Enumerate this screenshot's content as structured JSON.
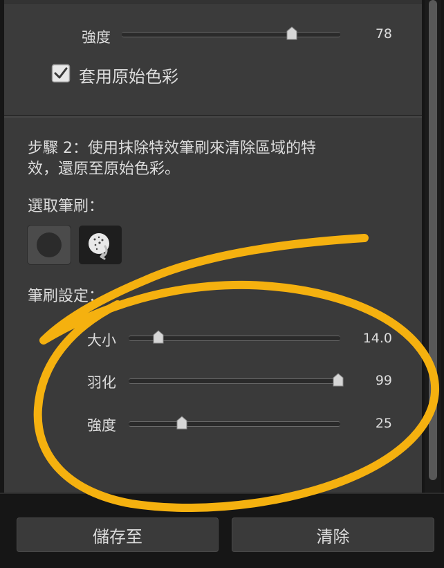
{
  "effect": {
    "strength_label": "強度",
    "strength_value": "78",
    "strength_level": 78,
    "checkbox_label": "套用原始色彩",
    "checkbox_checked": true
  },
  "step2": {
    "instruction_line1": "步驟 2：使用抹除特效筆刷來清除區域的特",
    "instruction_line2": "效，還原至原始色彩。",
    "choose_brush_label": "選取筆刷：",
    "brushes": [
      {
        "name": "round-brush",
        "selected": false
      },
      {
        "name": "eraser-brush",
        "selected": true
      }
    ],
    "brush_settings_label": "筆刷設定："
  },
  "brush_settings": [
    {
      "label": "大小",
      "value": "14.0",
      "level": 0.14
    },
    {
      "label": "羽化",
      "value": "99",
      "level": 0.99
    },
    {
      "label": "強度",
      "value": "25",
      "level": 0.25
    }
  ],
  "footer": {
    "save_label": "儲存至",
    "clear_label": "清除"
  },
  "colors": {
    "panel": "#3a3a3a",
    "background": "#161616",
    "annotation": "#f5b10f",
    "text": "#dcdcdc"
  }
}
